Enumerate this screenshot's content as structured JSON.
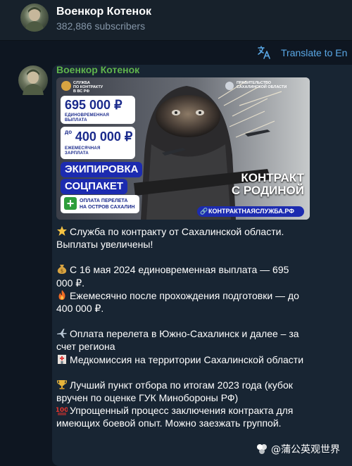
{
  "channel": {
    "title": "Военкор Котенок",
    "subscribers": "382,886 subscribers"
  },
  "translate_bar": {
    "label": "Translate to En",
    "icon": "translate-icon"
  },
  "message": {
    "sender": "Военкор Котенок",
    "poster": {
      "agency_left": "СЛУЖБА\nПО КОНТРАКТУ\nВ ВС РФ",
      "agency_right": "ПРАВИТЕЛЬСТВО\nСАХАЛИНСКОЙ ОБЛАСТИ",
      "pay_once_amount": "695 000 ₽",
      "pay_once_label": "ЕДИНОВРЕМЕННАЯ\nВЫПЛАТА",
      "monthly_prefix": "до",
      "monthly_amount": "400 000 ₽",
      "monthly_label": "ЕЖЕМЕСЯЧНАЯ\nЗАРПЛАТА",
      "equipment": "ЭКИПИРОВКА",
      "social": "СОЦПАКЕТ",
      "flight": "ОПЛАТА ПЕРЕЛЕТА\nНА ОСТРОВ САХАЛИН",
      "headline": "КОНТРАКТ\nС РОДИНОЙ",
      "site": "КОНТРАКТНАЯСЛУЖБА.РФ"
    },
    "lines": [
      {
        "emoji": "star",
        "text": "Служба по контракту от Сахалинской области. Выплаты увеличены!"
      },
      {
        "emoji": "money-bag",
        "text": "С 16 мая 2024 единовременная выплата — 695 000 ₽."
      },
      {
        "emoji": "fire",
        "text": "Ежемесячно после прохождения подготовки — до 400 000 ₽."
      },
      {
        "emoji": "airplane",
        "text": "Оплата перелета в Южно-Сахалинск и далее – за счет региона"
      },
      {
        "emoji": "hospital",
        "text": "Медкомиссия на территории Сахалинской области"
      },
      {
        "emoji": "trophy",
        "text": "Лучший пункт отбора по итогам 2023 года (кубок вручен по оценке ГУК Минобороны РФ)"
      },
      {
        "emoji": "hundred",
        "text": "Упрощенный процесс заключения контракта для имеющих боевой опыт. Можно заезжать группой."
      }
    ]
  },
  "watermark": {
    "text": "@蒲公英观世界"
  }
}
